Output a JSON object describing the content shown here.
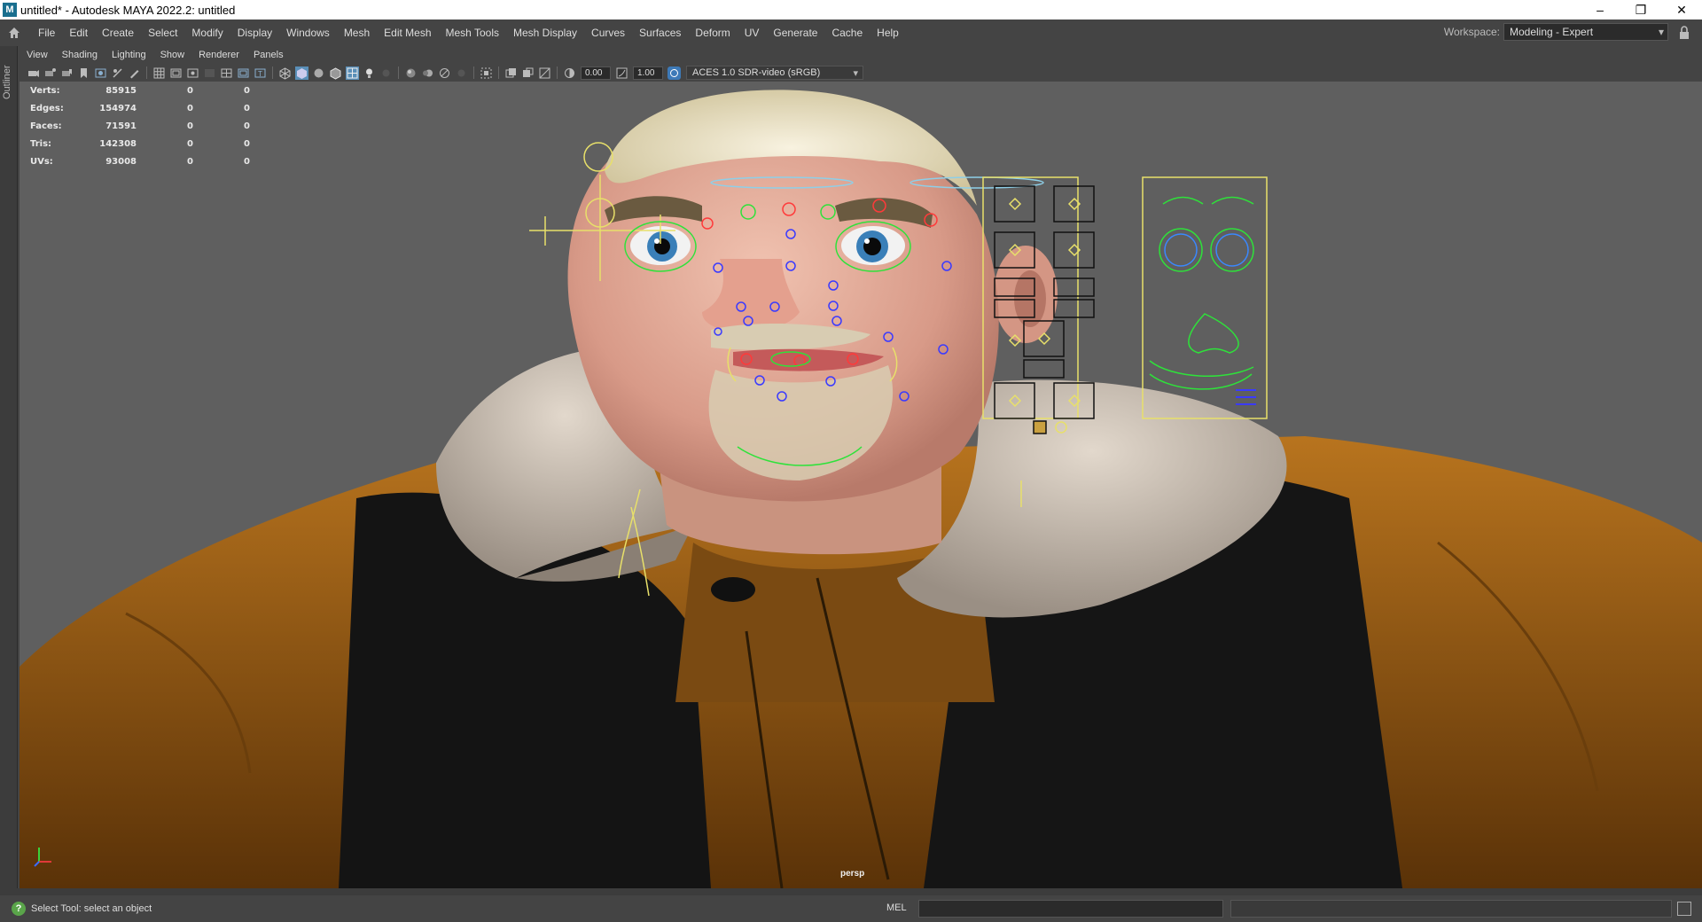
{
  "window": {
    "title": "untitled* - Autodesk MAYA 2022.2: untitled",
    "app_icon": "M",
    "controls": [
      "minimize-icon",
      "restore-icon",
      "close-icon"
    ]
  },
  "menubar": {
    "items": [
      "File",
      "Edit",
      "Create",
      "Select",
      "Modify",
      "Display",
      "Windows",
      "Mesh",
      "Edit Mesh",
      "Mesh Tools",
      "Mesh Display",
      "Curves",
      "Surfaces",
      "Deform",
      "UV",
      "Generate",
      "Cache",
      "Help"
    ],
    "workspace_label": "Workspace:",
    "workspace_value": "Modeling - Expert"
  },
  "outliner": {
    "label": "Outliner"
  },
  "panel_menu": {
    "items": [
      "View",
      "Shading",
      "Lighting",
      "Show",
      "Renderer",
      "Panels"
    ]
  },
  "panel_toolbar": {
    "exposure": "0.00",
    "gamma": "1.00",
    "color_space": "ACES 1.0 SDR-video (sRGB)"
  },
  "hud": {
    "rows": [
      {
        "label": "Verts:",
        "v1": "85915",
        "v2": "0",
        "v3": "0"
      },
      {
        "label": "Edges:",
        "v1": "154974",
        "v2": "0",
        "v3": "0"
      },
      {
        "label": "Faces:",
        "v1": "71591",
        "v2": "0",
        "v3": "0"
      },
      {
        "label": "Tris:",
        "v1": "142308",
        "v2": "0",
        "v3": "0"
      },
      {
        "label": "UVs:",
        "v1": "93008",
        "v2": "0",
        "v3": "0"
      }
    ]
  },
  "viewport": {
    "camera": "persp",
    "colors": {
      "background": "#5f5f5f",
      "jacket": "#a8681a",
      "skin": "#e0a896",
      "fur": "#cfc4b6",
      "ctrl_yellow": "#e8e06a",
      "ctrl_green": "#2ee23a",
      "ctrl_red": "#ff3a3a",
      "ctrl_blue": "#3a3aff"
    }
  },
  "status": {
    "help_text": "Select Tool: select an object",
    "mel_label": "MEL"
  }
}
